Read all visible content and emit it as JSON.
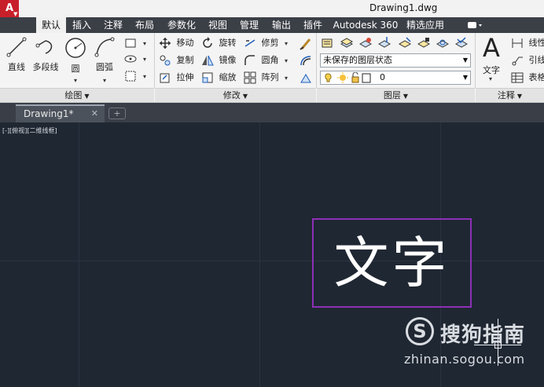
{
  "app": {
    "logo_letter": "A",
    "window_title": "Drawing1.dwg"
  },
  "ribbon_tabs": [
    "默认",
    "插入",
    "注释",
    "布局",
    "参数化",
    "视图",
    "管理",
    "输出",
    "插件",
    "Autodesk 360",
    "精选应用"
  ],
  "active_tab": "默认",
  "panels": {
    "draw": {
      "title": "绘图",
      "big_tools": [
        "直线",
        "多段线",
        "圆",
        "圆弧"
      ]
    },
    "modify": {
      "title": "修改",
      "tools": [
        "移动",
        "旋转",
        "修剪",
        "复制",
        "镜像",
        "圆角",
        "拉伸",
        "缩放",
        "阵列"
      ]
    },
    "layers": {
      "title": "图层",
      "layer_state": "未保存的图层状态",
      "current_layer": "0"
    },
    "annotation": {
      "title": "注释",
      "big_tool": "文字",
      "tools": [
        "线性",
        "引线",
        "表格"
      ]
    }
  },
  "file_tabs": [
    {
      "label": "Drawing1*",
      "close": "✕"
    }
  ],
  "new_tab_symbol": "+",
  "canvas": {
    "viewport_label": "[-][俯视][二维线框]",
    "text_object": "文字"
  },
  "watermark": {
    "logo": "S",
    "title": "搜狗指南",
    "url": "zhinan.sogou.com"
  },
  "colors": {
    "selection_box": "#8d2fb8",
    "canvas_bg": "#1f2732",
    "tab_bar": "#3b3f46"
  }
}
